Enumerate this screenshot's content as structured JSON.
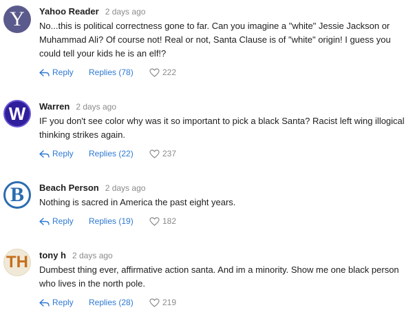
{
  "comments": [
    {
      "author": "Yahoo Reader",
      "time": "2 days ago",
      "avatar_letter": "Y",
      "text": "No...this is political correctness gone to far. Can you imagine a \"white\" Jessie Jackson or Muhammad Ali? Of course not! Real or not, Santa Clause is of \"white\" origin! I guess you could tell your kids he is an elf!?",
      "reply_label": "Reply",
      "replies_label": "Replies (78)",
      "likes": "222"
    },
    {
      "author": "Warren",
      "time": "2 days ago",
      "avatar_letter": "W",
      "text": "IF you don't see color why was it so important to pick a black Santa? Racist left wing illogical thinking strikes again.",
      "reply_label": "Reply",
      "replies_label": "Replies (22)",
      "likes": "237"
    },
    {
      "author": "Beach Person",
      "time": "2 days ago",
      "avatar_letter": "B",
      "text": "Nothing is sacred in America the past eight years.",
      "reply_label": "Reply",
      "replies_label": "Replies (19)",
      "likes": "182"
    },
    {
      "author": "tony h",
      "time": "2 days ago",
      "avatar_letter": "TH",
      "text": "Dumbest thing ever, affirmative action santa. And im a minority. Show me one black person who lives in the north pole.",
      "reply_label": "Reply",
      "replies_label": "Replies (28)",
      "likes": "219"
    }
  ],
  "icons": {
    "reply": "reply-arrow-icon",
    "like": "heart-outline-icon"
  },
  "colors": {
    "link": "#2d78d2",
    "muted": "#8a8a8a",
    "text": "#1d1d1f"
  }
}
